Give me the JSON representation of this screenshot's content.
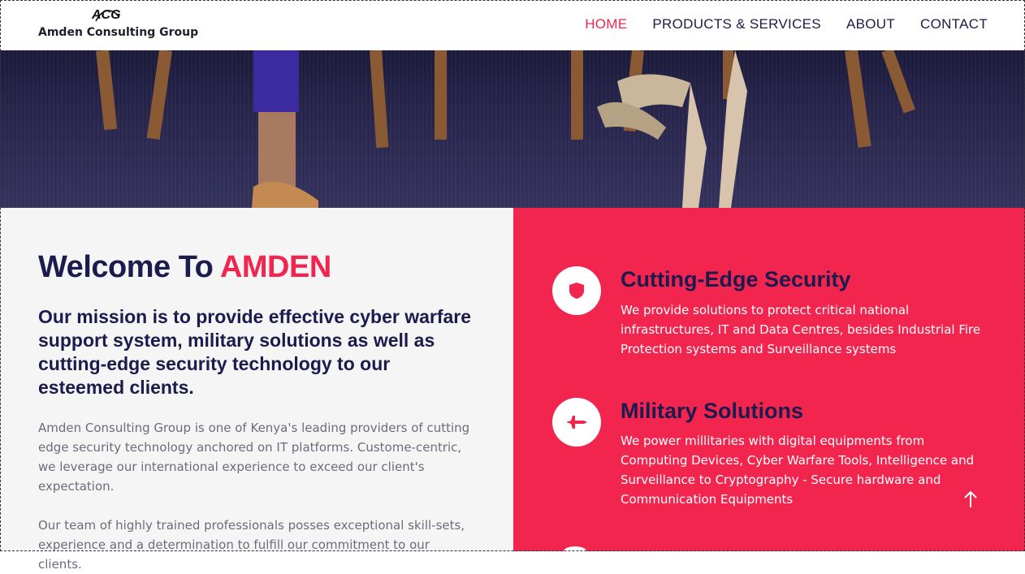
{
  "header": {
    "logo_text": "ACG",
    "brand_name": "Amden Consulting Group",
    "nav": [
      {
        "label": "HOME",
        "active": true
      },
      {
        "label": "PRODUCTS & SERVICES",
        "active": false
      },
      {
        "label": "ABOUT",
        "active": false
      },
      {
        "label": "CONTACT",
        "active": false
      }
    ]
  },
  "welcome": {
    "prefix": "Welcome To ",
    "highlight": "AMDEN",
    "mission": "Our mission is to provide effective cyber warfare support system, military solutions as well as cutting-edge security technology to our esteemed clients.",
    "paragraph1": "Amden Consulting Group is one of Kenya's leading providers of cutting edge security technology anchored on IT platforms. Custome-centric, we leverage our international experience to exceed our client's expectation.",
    "paragraph2": "Our team of highly trained professionals posses exceptional skill-sets, experience and a determination to fulfill our commitment to our clients."
  },
  "features": [
    {
      "icon": "shield-icon",
      "title": "Cutting-Edge Security",
      "description": "We provide solutions to protect critical national infrastructures, IT and Data Centres, besides Industrial Fire Protection systems and Surveillance systems"
    },
    {
      "icon": "jet-icon",
      "title": "Military Solutions",
      "description": "We power millitaries with digital equipments from Computing Devices, Cyber Warfare Tools, Intelligence and Surveillance to Cryptography - Secure hardware and Communication Equipments"
    }
  ],
  "colors": {
    "accent": "#f2254f",
    "navy": "#1c1b4d",
    "left_bg": "#f5f5f5"
  }
}
